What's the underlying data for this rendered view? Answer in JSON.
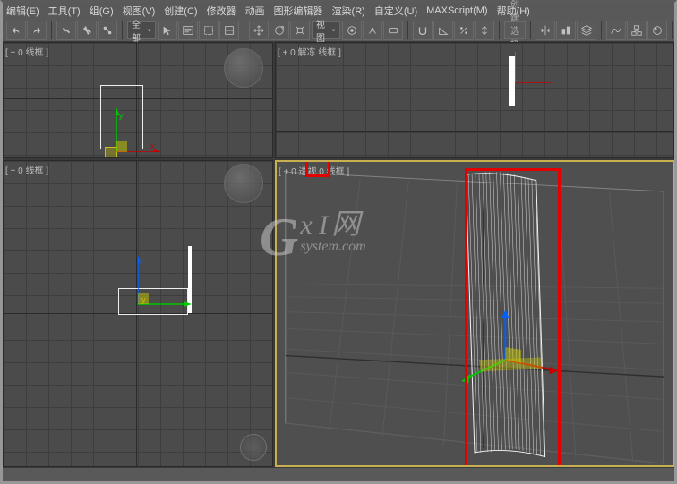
{
  "menu": {
    "items": [
      "编辑(E)",
      "工具(T)",
      "组(G)",
      "视图(V)",
      "创建(C)",
      "修改器",
      "动画",
      "图形编辑器",
      "渲染(R)",
      "自定义(U)",
      "MAXScript(M)",
      "帮助(H)"
    ]
  },
  "toolbar": {
    "dropdown1": "全部",
    "dropdown2": "视图",
    "searchPlaceholder": "创建选择集"
  },
  "viewports": {
    "topLeft": {
      "label": "[ + 0 线框 ]"
    },
    "topRight": {
      "label": "[ + 0 解冻 线框 ]"
    },
    "bottomLeft": {
      "label": "[ + 0 线框 ]"
    },
    "bottomRight": {
      "label": "[ + 0 透视 0 线框 ]"
    }
  },
  "watermark": {
    "g": "G",
    "xi": "x I",
    "sub": "system.com",
    "cn": "网"
  }
}
